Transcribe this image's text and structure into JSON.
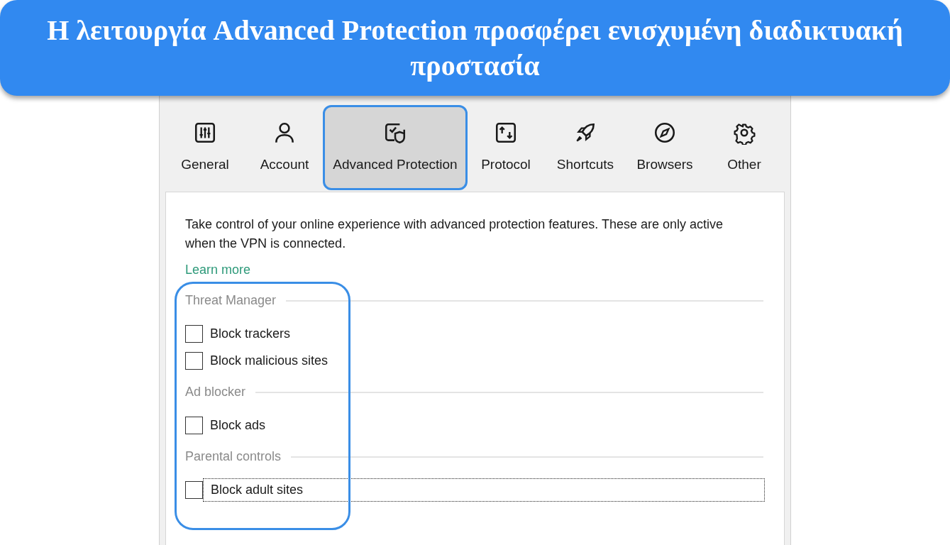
{
  "banner": {
    "text": "Η λειτουργία Advanced Protection προσφέρει ενισχυμένη διαδικτυακή προστασία"
  },
  "tabs": [
    {
      "label": "General",
      "selected": false
    },
    {
      "label": "Account",
      "selected": false
    },
    {
      "label": "Advanced Protection",
      "selected": true
    },
    {
      "label": "Protocol",
      "selected": false
    },
    {
      "label": "Shortcuts",
      "selected": false
    },
    {
      "label": "Browsers",
      "selected": false
    },
    {
      "label": "Other",
      "selected": false
    }
  ],
  "description": "Take control of your online experience with advanced protection features. These are only active when the VPN is connected.",
  "learn_more": "Learn more",
  "sections": [
    {
      "title": "Threat Manager",
      "options": [
        {
          "label": "Block trackers",
          "checked": false,
          "focused": false
        },
        {
          "label": "Block malicious sites",
          "checked": false,
          "focused": false
        }
      ]
    },
    {
      "title": "Ad blocker",
      "options": [
        {
          "label": "Block ads",
          "checked": false,
          "focused": false
        }
      ]
    },
    {
      "title": "Parental controls",
      "options": [
        {
          "label": "Block adult sites",
          "checked": false,
          "focused": true
        }
      ]
    }
  ]
}
